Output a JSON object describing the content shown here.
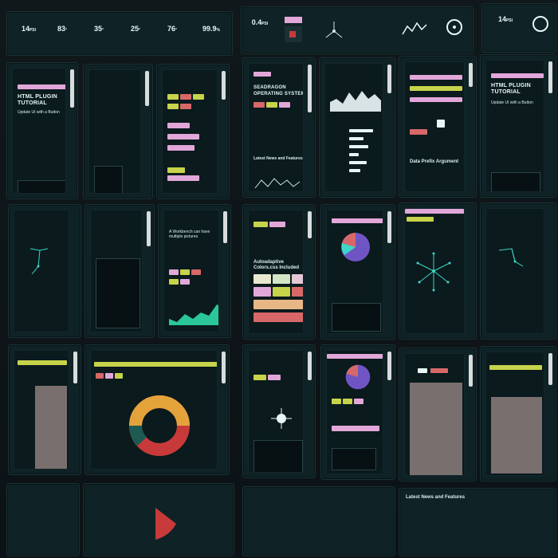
{
  "panels": {
    "html_tutorial": {
      "title": "HTML PLUGIN TUTORIAL",
      "subtitle": "Update UI with a Button"
    },
    "seadragon": {
      "title": "SEADRAGON OPERATING SYSTEM",
      "news": "Latest News and Features"
    },
    "prefix": {
      "title": "Data Prefix Argument"
    },
    "html_tutorial_2": {
      "title": "HTML PLUGIN TUTORIAL",
      "subtitle": "Update UI with a Button"
    },
    "workbench": {
      "title": "A Workbench can have multiple pictures"
    },
    "colors": {
      "title": "Autoadaptive Colors.css Included"
    },
    "news_bottom": {
      "title": "Latest News and Features"
    }
  },
  "top_stats": [
    {
      "value": "14",
      "unit": "PSI"
    },
    {
      "value": "83",
      "unit": "°"
    },
    {
      "value": "35",
      "unit": "°"
    },
    {
      "value": "25",
      "unit": "°"
    },
    {
      "value": "76",
      "unit": "°"
    },
    {
      "value": "99.9",
      "unit": "%"
    },
    {
      "value": "0.4",
      "unit": "PSI"
    },
    {
      "value": "14",
      "unit": "PSI"
    }
  ],
  "colors": {
    "pink": "#e2a7d9",
    "olive": "#c7d34a",
    "salmon": "#d86868",
    "teal": "#3ed7c7",
    "purple": "#6f55c4",
    "orange": "#e4a33a",
    "red": "#c83a3a",
    "navy": "#1a2f73"
  },
  "icons": [
    "chart-icon",
    "pie-chart-icon",
    "graph-icon",
    "gauge-icon",
    "network-icon"
  ]
}
